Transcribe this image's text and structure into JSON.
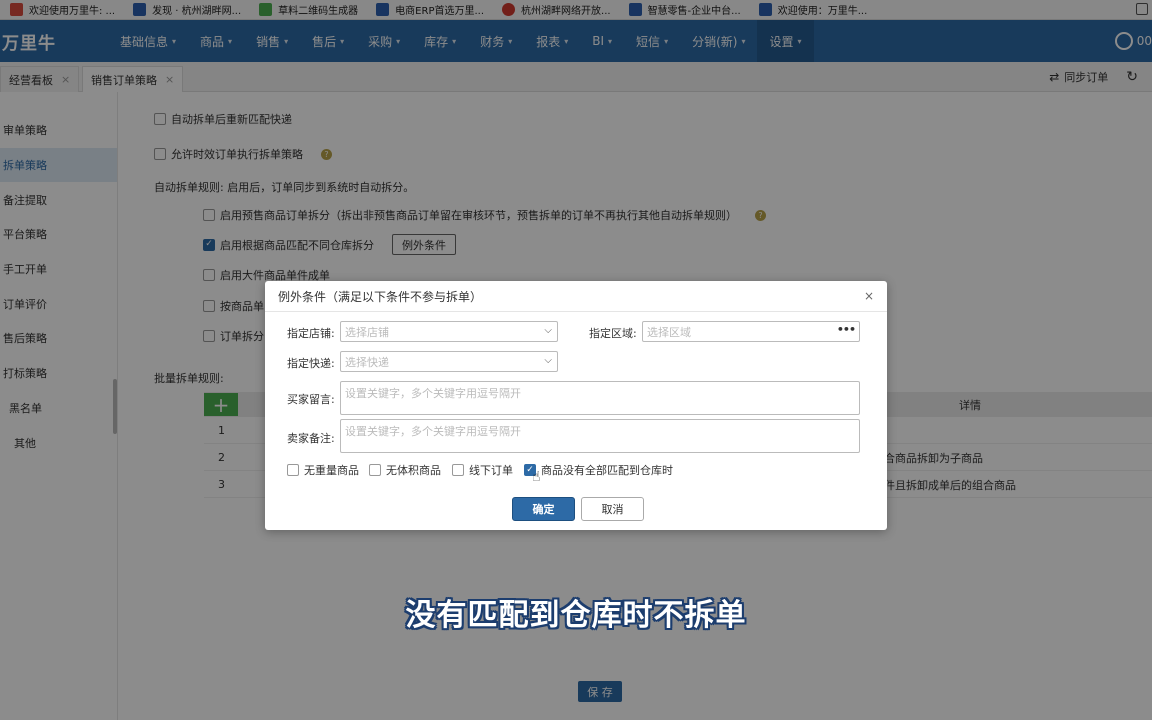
{
  "bookmarks": [
    {
      "label": "欢迎使用万里牛: ...",
      "icon": "bookmark-icon",
      "color": "#d94b3e"
    },
    {
      "label": "发现 · 杭州湖畔网...",
      "icon": "bookmark-icon",
      "color": "#2d5fb0"
    },
    {
      "label": "草料二维码生成器",
      "icon": "qrcode-icon",
      "color": "#4caf50"
    },
    {
      "label": "电商ERP首选万里...",
      "icon": "bookmark-icon",
      "color": "#2d5fb0"
    },
    {
      "label": "杭州湖畔网络开放...",
      "icon": "bookmark-icon",
      "color": "#d03a2f"
    },
    {
      "label": "智慧零售-企业中台...",
      "icon": "bookmark-icon",
      "color": "#2d5fb0"
    },
    {
      "label": "欢迎使用：万里牛...",
      "icon": "bookmark-icon",
      "color": "#2d5fb0"
    }
  ],
  "nav": {
    "logo": "万里牛",
    "items": [
      {
        "label": "基础信息",
        "caret": "▾"
      },
      {
        "label": "商品",
        "caret": "▾"
      },
      {
        "label": "销售",
        "caret": "▾"
      },
      {
        "label": "售后",
        "caret": "▾"
      },
      {
        "label": "采购",
        "caret": "▾"
      },
      {
        "label": "库存",
        "caret": "▾"
      },
      {
        "label": "财务",
        "caret": "▾"
      },
      {
        "label": "报表",
        "caret": "▾"
      },
      {
        "label": "BI",
        "caret": "▾"
      },
      {
        "label": "短信",
        "caret": "▾"
      },
      {
        "label": "分销(新)",
        "caret": "▾"
      },
      {
        "label": "设置",
        "caret": "▾"
      }
    ],
    "active_index": 11,
    "user_text": "00"
  },
  "tabs": {
    "items": [
      {
        "label": "经营看板",
        "close": "×"
      },
      {
        "label": "销售订单策略",
        "close": "×"
      }
    ],
    "sync_label": "同步订单"
  },
  "sidebar": {
    "items": [
      "审单策略",
      "拆单策略",
      "备注提取",
      "平台策略",
      "手工开单",
      "订单评价",
      "售后策略",
      "打标策略",
      "黑名单",
      "其他"
    ],
    "active_index": 1
  },
  "content": {
    "opt_resplit_match_express": "自动拆单后重新匹配快递",
    "opt_allow_timed_orders": "允许时效订单执行拆单策略",
    "auto_rule_heading": "自动拆单规则: 启用后，订单同步到系统时自动拆分。",
    "opt_presale": "启用预售商品订单拆分（拆出非预售商品订单留在审核环节，预售拆单的订单不再执行其他自动拆单规则）",
    "opt_warehouse": "启用根据商品匹配不同仓库拆分",
    "exception_button": "例外条件",
    "opt_large_item": "启用大件商品单件成单",
    "opt_by_goods_partial": "按商品单",
    "opt_order_split_partial": "订单拆分",
    "batch_heading": "批量拆单规则:",
    "table": {
      "add_label": "+",
      "detail_header": "详情",
      "rows": [
        {
          "num": "1",
          "detail": ""
        },
        {
          "num": "2",
          "detail": "合商品拆卸为子商品"
        },
        {
          "num": "3",
          "detail": "件且拆卸成单后的组合商品"
        }
      ]
    },
    "save_label": "保 存",
    "help_glyph": "?"
  },
  "modal": {
    "title": "例外条件（满足以下条件不参与拆单）",
    "close": "×",
    "shop_label": "指定店铺:",
    "shop_placeholder": "选择店铺",
    "region_label": "指定区域:",
    "region_placeholder": "选择区域",
    "express_label": "指定快递:",
    "express_placeholder": "选择快递",
    "buyer_msg_label": "买家留言:",
    "buyer_msg_placeholder": "设置关键字，多个关键字用逗号隔开",
    "seller_note_label": "卖家备注:",
    "seller_note_placeholder": "设置关键字，多个关键字用逗号隔开",
    "checks": [
      {
        "label": "无重量商品",
        "checked": false
      },
      {
        "label": "无体积商品",
        "checked": false
      },
      {
        "label": "线下订单",
        "checked": false
      },
      {
        "label": "商品没有全部匹配到仓库时",
        "checked": true
      }
    ],
    "confirm_label": "确定",
    "cancel_label": "取消"
  },
  "subtitle": "没有匹配到仓库时不拆单",
  "colors": {
    "brand": "#2d6aa6",
    "add_green": "#4caf50"
  }
}
